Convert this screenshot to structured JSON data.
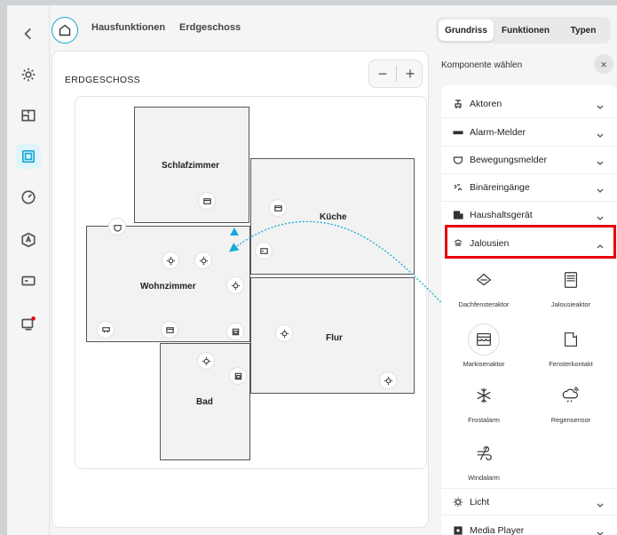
{
  "header": {
    "breadcrumb": [
      "Hausfunktionen",
      "Erdgeschoss"
    ],
    "view_tabs": [
      {
        "label": "Grundriss",
        "active": true
      },
      {
        "label": "Funktionen",
        "active": false
      },
      {
        "label": "Typen",
        "active": false
      }
    ]
  },
  "rail": {
    "icons": [
      "back-chevron-icon",
      "settings-gear-icon",
      "floorplan-icon",
      "house-functions-icon",
      "gauge-icon",
      "voice-assistant-icon",
      "display-icon",
      "notifications-icon"
    ],
    "active": "house-functions-icon"
  },
  "floor": {
    "title": "ERDGESCHOSS",
    "zoom_out": "−",
    "zoom_in": "+",
    "rooms": [
      {
        "name": "Schlafzimmer"
      },
      {
        "name": "Küche"
      },
      {
        "name": "Wohnzimmer"
      },
      {
        "name": "Flur"
      },
      {
        "name": "Bad"
      }
    ]
  },
  "panel": {
    "title": "Komponente wählen",
    "close": "×",
    "categories": [
      {
        "label": "Aktoren",
        "icon": "actor-icon",
        "expanded": false
      },
      {
        "label": "Alarm-Melder",
        "icon": "alarm-icon",
        "expanded": false
      },
      {
        "label": "Bewegungsmelder",
        "icon": "motion-sensor-icon",
        "expanded": false
      },
      {
        "label": "Binäreingänge",
        "icon": "binary-input-icon",
        "expanded": false
      },
      {
        "label": "Haushaltsgerät",
        "icon": "appliance-icon",
        "expanded": false
      },
      {
        "label": "Jalousien",
        "icon": "blinds-icon",
        "expanded": true
      },
      {
        "label": "Licht",
        "icon": "light-icon",
        "expanded": false
      },
      {
        "label": "Media Player",
        "icon": "media-player-icon",
        "expanded": false
      }
    ],
    "jalousien_items": [
      {
        "label": "Dachfensteraktor",
        "icon": "roof-window-icon"
      },
      {
        "label": "Jalousieaktor",
        "icon": "blind-actuator-icon"
      },
      {
        "label": "Markisenaktor",
        "icon": "awning-icon"
      },
      {
        "label": "Fensterkontakt",
        "icon": "window-contact-icon"
      },
      {
        "label": "Frostalarm",
        "icon": "frost-icon"
      },
      {
        "label": "Regensensor",
        "icon": "rain-sensor-icon"
      },
      {
        "label": "Windalarm",
        "icon": "wind-icon"
      }
    ],
    "highlight_color": "#e8000b"
  },
  "accent_color": "#19a9d6"
}
